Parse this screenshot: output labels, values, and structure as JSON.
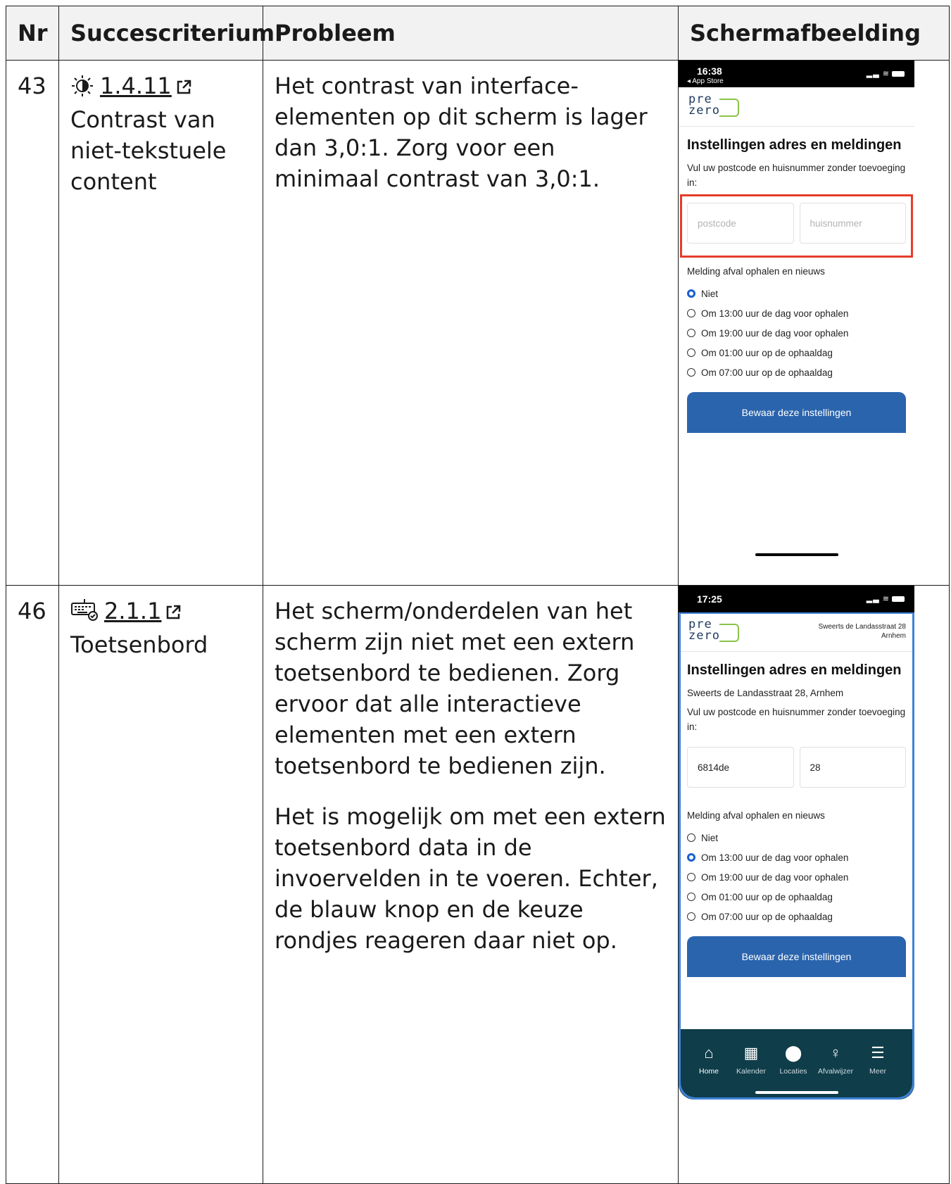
{
  "headers": {
    "nr": "Nr",
    "criterion": "Succescriterium",
    "problem": "Probleem",
    "screenshot": "Schermafbeelding"
  },
  "rows": [
    {
      "nr": "43",
      "criterion_code": "1.4.11",
      "criterion_name": "Contrast van niet-tekstuele content",
      "criterion_icon": "contrast-icon",
      "problem_paragraphs": [
        "Het contrast van interface-elementen op dit scherm is lager dan 3,0:1. Zorg voor een minimaal contrast van 3,0:1."
      ],
      "screenshot": {
        "time": "16:38",
        "back_label": "◂ App Store",
        "logo_top": "pre",
        "logo_bottom": "zero",
        "title": "Instellingen adres en meldingen",
        "instruction": "Vul uw postcode en huisnummer zonder toevoeging in:",
        "postcode_placeholder": "postcode",
        "housenumber_placeholder": "huisnummer",
        "notification_label": "Melding afval ophalen en nieuws",
        "options": [
          "Niet",
          "Om 13:00 uur de dag voor ophalen",
          "Om 19:00 uur de dag voor ophalen",
          "Om 01:00 uur op de ophaaldag",
          "Om 07:00 uur op de ophaaldag"
        ],
        "selected_option": 0,
        "save_button": "Bewaar deze instellingen",
        "highlight_color": "#e53d2a"
      }
    },
    {
      "nr": "46",
      "criterion_code": "2.1.1",
      "criterion_name": "Toetsenbord",
      "criterion_icon": "keyboard-icon",
      "problem_paragraphs": [
        "Het scherm/onderdelen van het scherm zijn niet met een extern toetsenbord te bedienen. Zorg ervoor dat alle interactieve elementen met een extern toetsenbord te bedienen zijn.",
        "Het is mogelijk om met een extern toetsenbord data in de invoervelden in te voeren. Echter, de blauw knop en de keuze rondjes reageren daar niet op."
      ],
      "screenshot": {
        "time": "17:25",
        "logo_top": "pre",
        "logo_bottom": "zero",
        "header_address_line1": "Sweerts de Landasstraat 28",
        "header_address_line2": "Arnhem",
        "title": "Instellingen adres en meldingen",
        "address": "Sweerts de Landasstraat 28, Arnhem",
        "instruction": "Vul uw postcode en huisnummer zonder toevoeging in:",
        "postcode_value": "6814de",
        "housenumber_value": "28",
        "notification_label": "Melding afval ophalen en nieuws",
        "options": [
          "Niet",
          "Om 13:00 uur de dag voor ophalen",
          "Om 19:00 uur de dag voor ophalen",
          "Om 01:00 uur op de ophaaldag",
          "Om 07:00 uur op de ophaaldag"
        ],
        "selected_option": 1,
        "save_button": "Bewaar deze instellingen",
        "nav": [
          {
            "label": "Home",
            "icon": "home-icon"
          },
          {
            "label": "Kalender",
            "icon": "calendar-icon"
          },
          {
            "label": "Locaties",
            "icon": "location-pin-icon"
          },
          {
            "label": "Afvalwijzer",
            "icon": "lightbulb-icon"
          },
          {
            "label": "Meer",
            "icon": "list-icon"
          }
        ],
        "focus_color": "#3d82d9"
      }
    }
  ]
}
